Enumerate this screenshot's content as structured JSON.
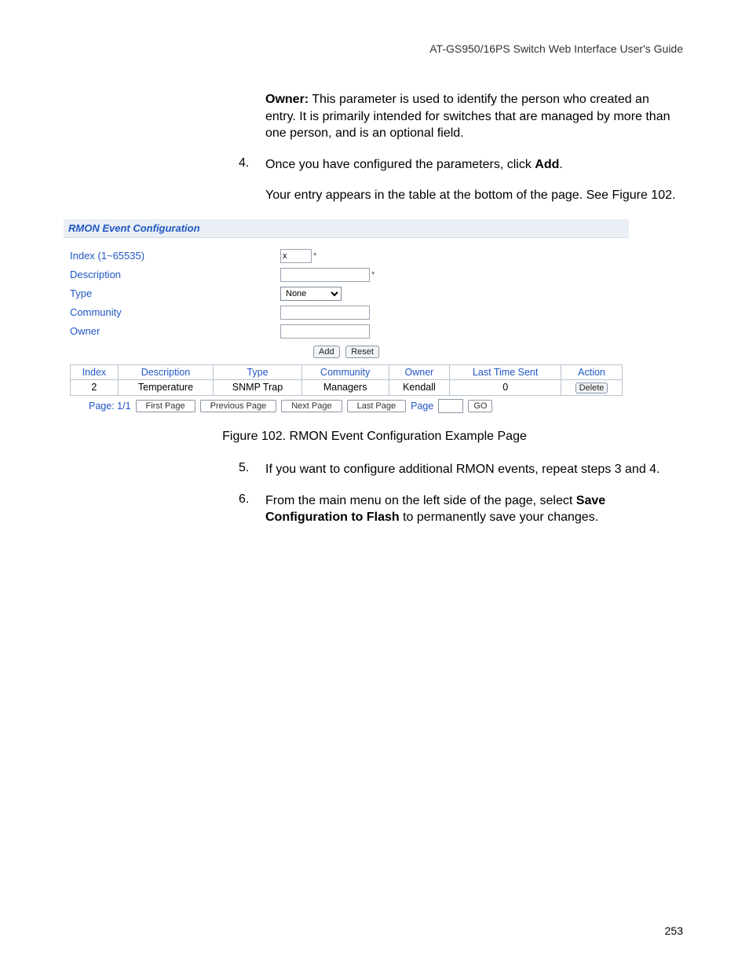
{
  "header": {
    "running": "AT-GS950/16PS Switch Web Interface User's Guide"
  },
  "intro": {
    "owner_label": "Owner:",
    "owner_text": " This parameter is used to identify the person who created an entry. It is primarily intended for switches that are managed by more than one person, and is an optional field."
  },
  "steps": {
    "s4": {
      "num": "4.",
      "text_a": "Once you have configured the parameters, click ",
      "text_bold": "Add",
      "text_c": ".",
      "after": "Your entry appears in the table at the bottom of the page. See Figure 102."
    },
    "s5": {
      "num": "5.",
      "text": "If you want to configure additional RMON events, repeat steps 3 and 4."
    },
    "s6": {
      "num": "6.",
      "text_a": "From the main menu on the left side of the page, select ",
      "bold1": "Save Configuration to Flash",
      "text_b": " to permanently save your changes."
    }
  },
  "shot": {
    "title": "RMON Event Configuration",
    "fields": {
      "index_label": "Index (1~65535)",
      "description_label": "Description",
      "type_label": "Type",
      "community_label": "Community",
      "owner_label": "Owner",
      "index_value": "x",
      "type_value": "None",
      "star": "*"
    },
    "buttons": {
      "add": "Add",
      "reset": "Reset"
    },
    "table": {
      "headers": [
        "Index",
        "Description",
        "Type",
        "Community",
        "Owner",
        "Last Time Sent",
        "Action"
      ],
      "row": {
        "index": "2",
        "description": "Temperature",
        "type": "SNMP Trap",
        "community": "Managers",
        "owner": "Kendall",
        "last": "0",
        "action": "Delete"
      }
    },
    "pager": {
      "page_label": "Page: 1/1",
      "first": "First Page",
      "prev": "Previous Page",
      "next": "Next Page",
      "last": "Last Page",
      "page_word": "Page",
      "go": "GO"
    }
  },
  "caption": "Figure 102. RMON Event Configuration Example Page",
  "page_number": "253"
}
